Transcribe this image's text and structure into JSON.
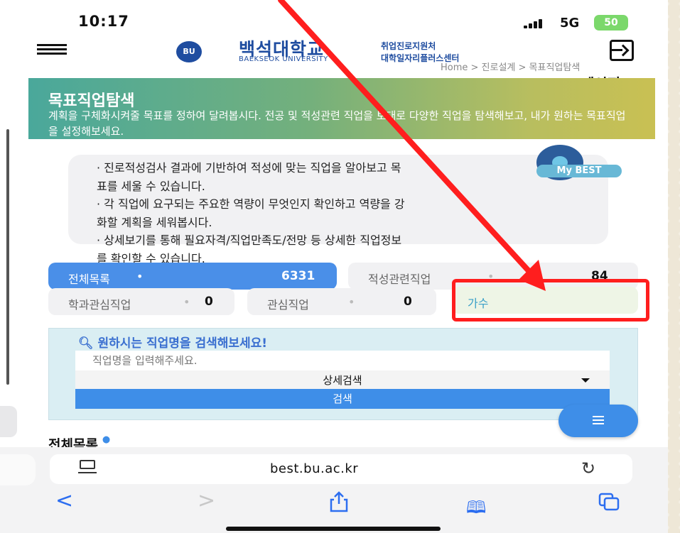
{
  "status_bar": {
    "time": "10:17",
    "network": "5G",
    "battery": "50"
  },
  "header": {
    "logo_text": "BU",
    "univ_name_ko": "백석대학교",
    "univ_name_en": "BAEKSEOK UNIVERSITY",
    "center_line1": "취업진로지원처",
    "center_line2": "대학일자리플러스센터",
    "breadcrumb": "Home > 진로설계 > 목표직업탐색",
    "my_page": "My 페이지"
  },
  "banner": {
    "title": "목표직업탐색",
    "description": "계획을 구체화시켜줄 목표를 정하여 달려봅시다. 전공 및 적성관련 직업을 토대로 다양한 직업을 탐색해보고, 내가 원하는 목표직업을 설정해보세요."
  },
  "info": {
    "lines": [
      "· 진로적성검사 결과에 기반하여 적성에 맞는 직업을 알아보고 목",
      "표를 세울 수 있습니다.",
      "· 각 직업에 요구되는 주요한 역량이 무엇인지 확인하고 역량을 강",
      "화할 계획을 세워봅시다.",
      "· 상세보기를 통해 필요자격/직업만족도/전망 등 상세한 직업정보",
      "를 확인할 수 있습니다."
    ],
    "badge": "My BEST"
  },
  "filters": {
    "all": {
      "label": "전체목록",
      "count": "6331"
    },
    "aptitude": {
      "label": "적성관련직업",
      "count": "84"
    },
    "major": {
      "label": "학과관심직업",
      "count": "0"
    },
    "interest": {
      "label": "관심직업",
      "count": "0"
    },
    "selected_job": "가수"
  },
  "search": {
    "title": "원하시는 직업명을 검색해보세요!",
    "placeholder": "직업명을 입력해주세요.",
    "detail_label": "상세검색",
    "button_label": "검색"
  },
  "list": {
    "title": "전체목록"
  },
  "browser": {
    "url": "best.bu.ac.kr"
  },
  "colors": {
    "accent_blue": "#4a8fe8",
    "annotation_red": "#ff1e1e",
    "brand_navy": "#1f4da0"
  }
}
